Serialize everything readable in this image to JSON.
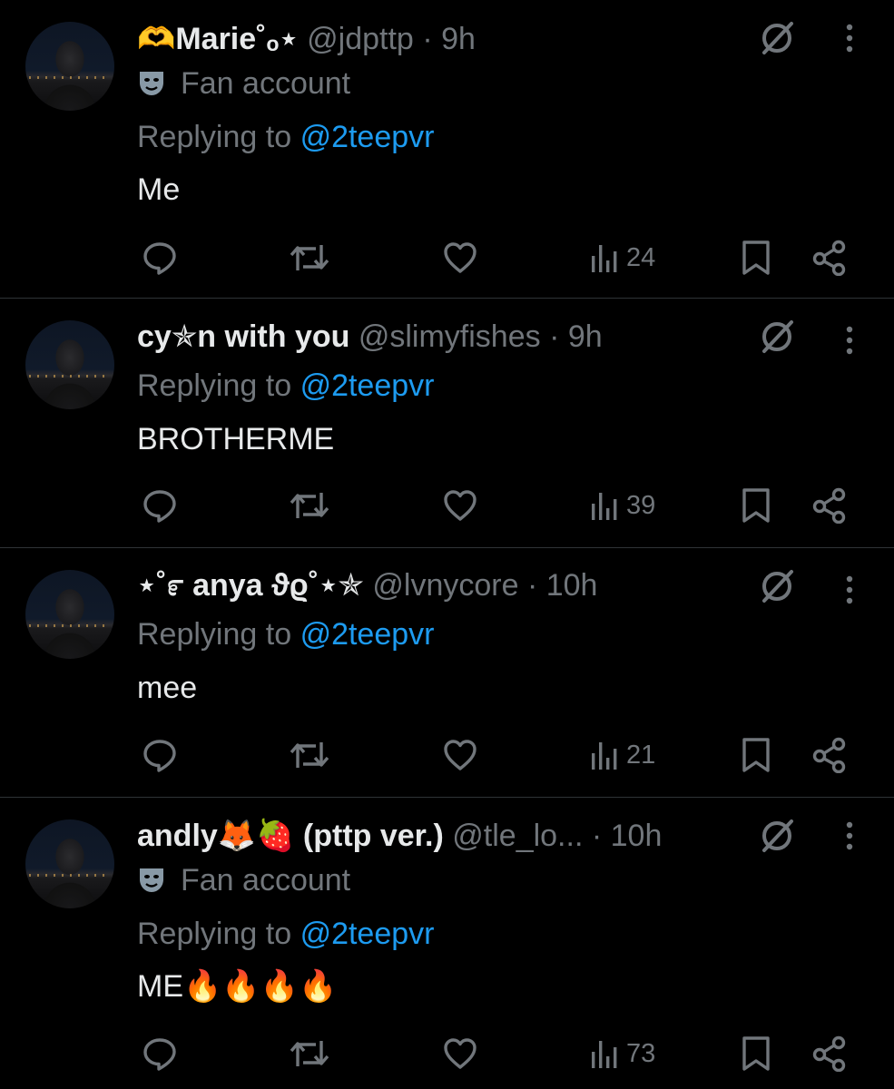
{
  "replies": [
    {
      "name": "🫶Marie˚ₒ⋆",
      "handle": "@jdpttp",
      "separator": "·",
      "time": "9h",
      "badge": "Fan account",
      "replying_prefix": "Replying to",
      "replying_to": "@2teepvr",
      "text": "Me",
      "views": "24"
    },
    {
      "name": "cy✯n with you",
      "handle": "@slimyfishes",
      "separator": "·",
      "time": "9h",
      "replying_prefix": "Replying to",
      "replying_to": "@2teepvr",
      "text": "BROTHERME",
      "views": "39"
    },
    {
      "name": "⋆˚೯ anya ϑϱ˚⋆✯",
      "handle": "@lvnycore",
      "separator": "·",
      "time": "10h",
      "replying_prefix": "Replying to",
      "replying_to": "@2teepvr",
      "text": "mee",
      "views": "21"
    },
    {
      "name": "andly🦊🍓 (pttp ver.)",
      "handle": "@tle_lo...",
      "separator": "·",
      "time": "10h",
      "badge": "Fan account",
      "replying_prefix": "Replying to",
      "replying_to": "@2teepvr",
      "text": "ME🔥🔥🔥🔥",
      "views": "73"
    }
  ],
  "colors": {
    "background": "#000000",
    "primary_text": "#e7e9ea",
    "secondary_text": "#71767b",
    "accent": "#1d9bf0",
    "divider": "#2f3336"
  },
  "icons": {
    "reply": "reply-icon",
    "repost": "repost-icon",
    "like": "like-icon",
    "views": "views-icon",
    "bookmark": "bookmark-icon",
    "share": "share-icon",
    "grok": "grok-icon",
    "more": "more-icon",
    "badge": "mask-icon"
  }
}
